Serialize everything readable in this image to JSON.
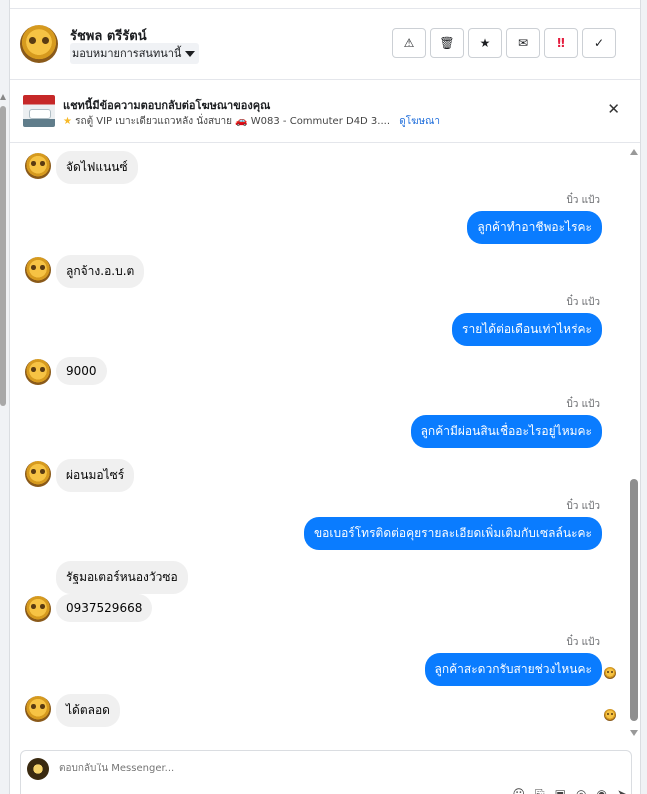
{
  "header": {
    "name": "รัชพล ตรีรัตน์",
    "assign_label": "มอบหมายการสนทนานี้",
    "actions": [
      {
        "name": "report-spam-button",
        "icon": "warning-icon",
        "glyph": "⚠"
      },
      {
        "name": "delete-button",
        "icon": "trash-icon",
        "glyph": "🗑"
      },
      {
        "name": "star-button",
        "icon": "star-icon",
        "glyph": "★"
      },
      {
        "name": "mark-unread-button",
        "icon": "envelope-open-icon",
        "glyph": "✉"
      },
      {
        "name": "follow-up-button",
        "icon": "double-exclamation-icon",
        "glyph": "‼"
      },
      {
        "name": "mark-done-button",
        "icon": "check-icon",
        "glyph": "✓"
      }
    ]
  },
  "banner": {
    "title": "แชทนี้มีข้อความตอบกลับต่อโฆษณาของคุณ",
    "ad_desc_prefix": "รถตู้ VIP เบาะเดียวแถวหลัง นั่งสบาย",
    "ad_desc_suffix": "W083 - Commuter D4D 3....",
    "view_ad": "ดูโฆษณา",
    "close_glyph": "✕"
  },
  "messages": [
    {
      "dir": "in",
      "text": "จัดไฟแนนซ์"
    },
    {
      "dir": "out",
      "sender": "บิ๋ว แป้ว",
      "text": "ลูกค้าทำอาชีพอะไรคะ"
    },
    {
      "dir": "in",
      "text": "ลูกจ้าง.อ.บ.ต"
    },
    {
      "dir": "out",
      "sender": "บิ๋ว แป้ว",
      "text": "รายได้ต่อเดือนเท่าไหร่คะ"
    },
    {
      "dir": "in",
      "text": "9000"
    },
    {
      "dir": "out",
      "sender": "บิ๋ว แป้ว",
      "text": "ลูกค้ามีผ่อนสินเชื่ออะไรอยู่ไหมคะ"
    },
    {
      "dir": "in",
      "text": "ผ่อนมอไซร์"
    },
    {
      "dir": "out",
      "sender": "บิ๋ว แป้ว",
      "text": "ขอเบอร์โทรติดต่อคุยรายละเอียดเพิ่มเติมกับเซลล์นะคะ"
    },
    {
      "dir": "in",
      "text": "รัฐมอเตอร์หนองวัวซอ"
    },
    {
      "dir": "in",
      "text": "0937529668"
    },
    {
      "dir": "out",
      "sender": "บิ๋ว แป้ว",
      "text": "ลูกค้าสะดวกรับสายช่วงไหนคะ"
    },
    {
      "dir": "in",
      "text": "ได้ตลอด"
    }
  ],
  "composer": {
    "placeholder": "ตอบกลับใน Messenger...",
    "icons": [
      "emoji-icon",
      "attach-icon",
      "image-icon",
      "gif-icon",
      "like-icon",
      "send-icon"
    ]
  },
  "colors": {
    "outgoing": "#0a7cff",
    "incoming": "#f0f0f0",
    "link": "#216fdb",
    "danger": "#e41e3f"
  }
}
